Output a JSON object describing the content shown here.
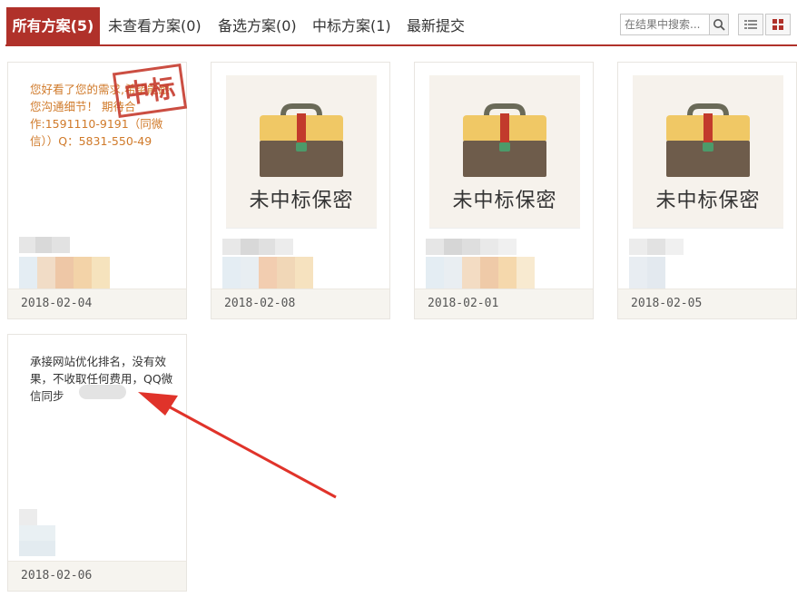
{
  "tabs": [
    {
      "label": "所有方案(5)",
      "active": true
    },
    {
      "label": "未查看方案(0)",
      "active": false
    },
    {
      "label": "备选方案(0)",
      "active": false
    },
    {
      "label": "中标方案(1)",
      "active": false
    },
    {
      "label": "最新提交",
      "active": false
    }
  ],
  "search": {
    "placeholder": "在结果中搜索..."
  },
  "icons": {
    "search": "search-icon",
    "list_view": "list-view-icon",
    "grid_view": "grid-view-icon"
  },
  "colors": {
    "accent": "#b0312a",
    "stamp": "#c63b2e",
    "desc_orange": "#d07a2a"
  },
  "cards": [
    {
      "description": "您好看了您的需求,希望能跟您沟通细节！ 期待合作:1591110-9191（同微信））Q：5831-550-49",
      "stamp": "中标",
      "date": "2018-02-04"
    },
    {
      "thumb_text": "未中标保密",
      "date": "2018-02-08"
    },
    {
      "thumb_text": "未中标保密",
      "date": "2018-02-01"
    },
    {
      "thumb_text": "未中标保密",
      "date": "2018-02-05"
    },
    {
      "description": "承接网站优化排名，没有效果，不收取任何费用，QQ微信同步",
      "date": "2018-02-06"
    }
  ]
}
